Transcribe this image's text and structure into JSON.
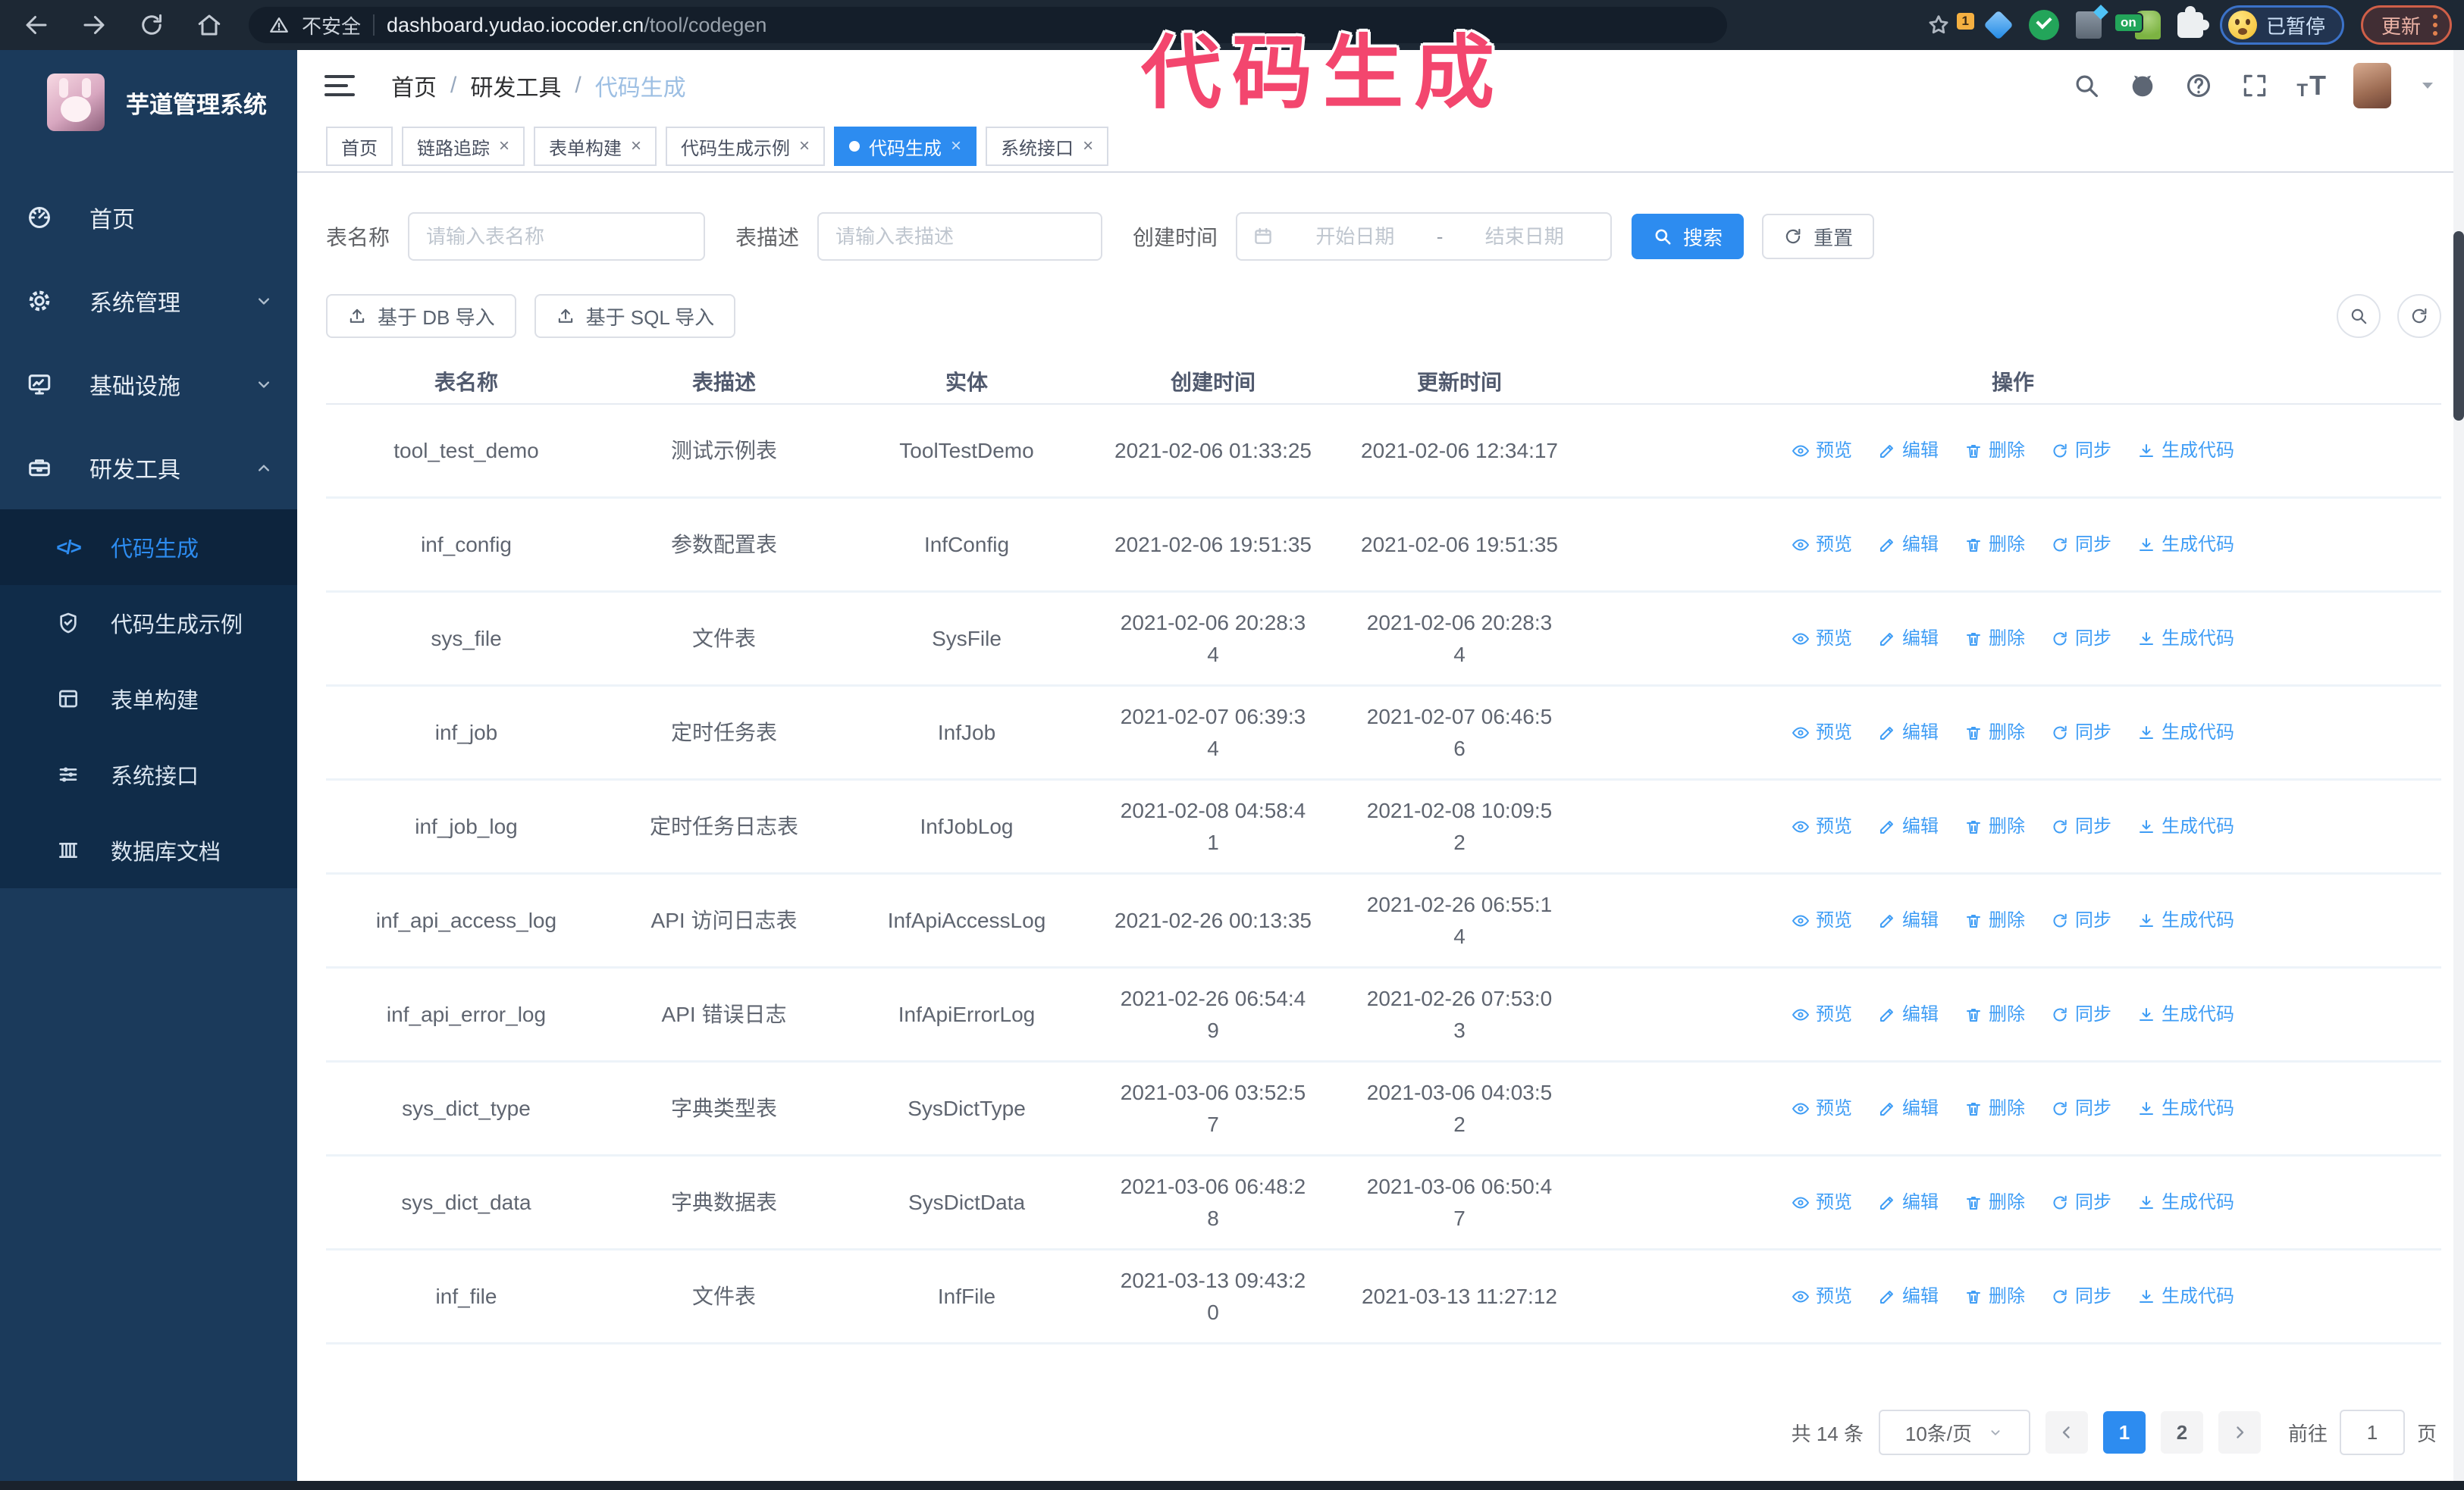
{
  "browser": {
    "security_label": "不安全",
    "url_host": "dashboard.yudao.iocoder.cn",
    "url_path": "/tool/codegen",
    "extension_badge_count": "1",
    "extension_badge_on": "on",
    "paused_label": "已暂停",
    "update_label": "更新"
  },
  "annotation": {
    "text": "代码生成",
    "color": "#f3466e"
  },
  "sidebar": {
    "title": "芋道管理系统",
    "items": [
      {
        "label": "首页"
      },
      {
        "label": "系统管理"
      },
      {
        "label": "基础设施"
      },
      {
        "label": "研发工具"
      }
    ],
    "subitems": [
      {
        "label": "代码生成"
      },
      {
        "label": "代码生成示例"
      },
      {
        "label": "表单构建"
      },
      {
        "label": "系统接口"
      },
      {
        "label": "数据库文档"
      }
    ]
  },
  "header": {
    "breadcrumb": {
      "home": "首页",
      "section": "研发工具",
      "current": "代码生成",
      "separator": "/"
    }
  },
  "tabs": [
    {
      "label": "首页"
    },
    {
      "label": "链路追踪"
    },
    {
      "label": "表单构建"
    },
    {
      "label": "代码生成示例"
    },
    {
      "label": "代码生成"
    },
    {
      "label": "系统接口"
    }
  ],
  "filters": {
    "table_name_label": "表名称",
    "table_name_placeholder": "请输入表名称",
    "table_desc_label": "表描述",
    "table_desc_placeholder": "请输入表描述",
    "create_time_label": "创建时间",
    "start_placeholder": "开始日期",
    "range_separator": "-",
    "end_placeholder": "结束日期",
    "search_label": "搜索",
    "reset_label": "重置"
  },
  "toolbar": {
    "import_db_label": "基于 DB 导入",
    "import_sql_label": "基于 SQL 导入"
  },
  "table": {
    "columns": [
      "表名称",
      "表描述",
      "实体",
      "创建时间",
      "更新时间",
      "操作"
    ],
    "actions": [
      {
        "label": "预览",
        "icon": "eye-icon",
        "name": "preview-link"
      },
      {
        "label": "编辑",
        "icon": "edit-icon",
        "name": "edit-link"
      },
      {
        "label": "删除",
        "icon": "delete-icon",
        "name": "delete-link"
      },
      {
        "label": "同步",
        "icon": "sync-icon",
        "name": "sync-link"
      },
      {
        "label": "生成代码",
        "icon": "download-icon",
        "name": "generate-code-link"
      }
    ],
    "rows": [
      {
        "name": "tool_test_demo",
        "desc": "测试示例表",
        "entity": "ToolTestDemo",
        "created_lines": [
          "2021-02-06 01:33:25"
        ],
        "updated_lines": [
          "2021-02-06 12:34:17"
        ]
      },
      {
        "name": "inf_config",
        "desc": "参数配置表",
        "entity": "InfConfig",
        "created_lines": [
          "2021-02-06 19:51:35"
        ],
        "updated_lines": [
          "2021-02-06 19:51:35"
        ]
      },
      {
        "name": "sys_file",
        "desc": "文件表",
        "entity": "SysFile",
        "created_lines": [
          "2021-02-06 20:28:3",
          "4"
        ],
        "updated_lines": [
          "2021-02-06 20:28:3",
          "4"
        ]
      },
      {
        "name": "inf_job",
        "desc": "定时任务表",
        "entity": "InfJob",
        "created_lines": [
          "2021-02-07 06:39:3",
          "4"
        ],
        "updated_lines": [
          "2021-02-07 06:46:5",
          "6"
        ]
      },
      {
        "name": "inf_job_log",
        "desc": "定时任务日志表",
        "entity": "InfJobLog",
        "created_lines": [
          "2021-02-08 04:58:4",
          "1"
        ],
        "updated_lines": [
          "2021-02-08 10:09:5",
          "2"
        ]
      },
      {
        "name": "inf_api_access_log",
        "desc": "API 访问日志表",
        "entity": "InfApiAccessLog",
        "created_lines": [
          "2021-02-26 00:13:35"
        ],
        "updated_lines": [
          "2021-02-26 06:55:1",
          "4"
        ]
      },
      {
        "name": "inf_api_error_log",
        "desc": "API 错误日志",
        "entity": "InfApiErrorLog",
        "created_lines": [
          "2021-02-26 06:54:4",
          "9"
        ],
        "updated_lines": [
          "2021-02-26 07:53:0",
          "3"
        ]
      },
      {
        "name": "sys_dict_type",
        "desc": "字典类型表",
        "entity": "SysDictType",
        "created_lines": [
          "2021-03-06 03:52:5",
          "7"
        ],
        "updated_lines": [
          "2021-03-06 04:03:5",
          "2"
        ]
      },
      {
        "name": "sys_dict_data",
        "desc": "字典数据表",
        "entity": "SysDictData",
        "created_lines": [
          "2021-03-06 06:48:2",
          "8"
        ],
        "updated_lines": [
          "2021-03-06 06:50:4",
          "7"
        ]
      },
      {
        "name": "inf_file",
        "desc": "文件表",
        "entity": "InfFile",
        "created_lines": [
          "2021-03-13 09:43:2",
          "0"
        ],
        "updated_lines": [
          "2021-03-13 11:27:12"
        ]
      }
    ]
  },
  "pagination": {
    "total_label": "共 14 条",
    "page_size": "10条/页",
    "pages": [
      "1",
      "2"
    ],
    "active_page": "1",
    "goto_label": "前往",
    "goto_value": "1",
    "page_suffix": "页"
  },
  "colors": {
    "accent": "#2d8cf0",
    "link": "#3f9df5",
    "sidebar_bg": "#1b3a5b",
    "submenu_bg": "#102c49",
    "browser_bar_bg": "#1d2834",
    "annotation_pink": "#f3466e",
    "paused_border": "#3b72c8",
    "update_border": "#cf5f48"
  }
}
